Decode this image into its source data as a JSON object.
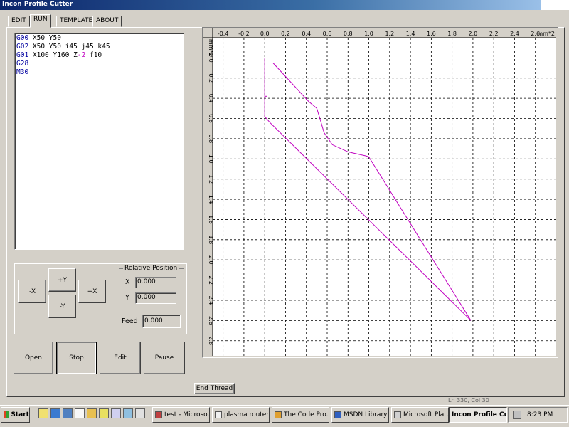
{
  "window": {
    "title": "Incon Profile Cutter"
  },
  "tabs": [
    {
      "label": "EDIT",
      "active": false
    },
    {
      "label": "RUN",
      "active": true
    },
    {
      "label": "TEMPLATE",
      "active": false
    },
    {
      "label": "ABOUT",
      "active": false
    }
  ],
  "editor": {
    "lines": [
      {
        "cmd": "G00",
        "rest": " X50 Y50",
        "neg": "",
        "tail": ""
      },
      {
        "cmd": "G02",
        "rest": " X50 Y50 i45 j45 k45",
        "neg": "",
        "tail": ""
      },
      {
        "cmd": "G01",
        "rest": " X100 Y160 Z",
        "neg": "-2",
        "tail": " f10"
      },
      {
        "cmd": "G28",
        "rest": "",
        "neg": "",
        "tail": ""
      },
      {
        "cmd": "M30",
        "rest": "",
        "neg": "",
        "tail": ""
      }
    ]
  },
  "jog": {
    "minus_x": "-X",
    "plus_y": "+Y",
    "plus_x": "+X",
    "minus_y": "-Y"
  },
  "relative_position": {
    "title": "Relative Position",
    "x_label": "X",
    "x_value": "0.000",
    "y_label": "Y",
    "y_value": "0.000"
  },
  "feed": {
    "label": "Feed",
    "value": "0.000"
  },
  "controls": {
    "open": "Open",
    "stop": "Stop",
    "edit": "Edit",
    "pause": "Pause"
  },
  "end_thread": "End Thread",
  "status_line": "Ln 330, Col 30",
  "plot": {
    "x_unit": "mm*2",
    "y_unit": "mm*2",
    "x_ticks": [
      "-0.4",
      "-0.2",
      "0.0",
      "0.2",
      "0.4",
      "0.6",
      "0.8",
      "1.0",
      "1.2",
      "1.4",
      "1.6",
      "1.8",
      "2.0",
      "2.2",
      "2.4",
      "2.6"
    ],
    "y_ticks": [
      "0.0",
      "0.2",
      "0.4",
      "0.6",
      "0.8",
      "1.0",
      "1.2",
      "1.4",
      "1.6",
      "1.8",
      "2.0",
      "2.2",
      "2.4",
      "2.6",
      "2.8"
    ],
    "path_color": "#c000c0"
  },
  "chart_data": {
    "type": "line",
    "xlim": [
      -0.5,
      2.8
    ],
    "ylim": [
      -0.2,
      2.95
    ],
    "y_inverted": true,
    "grid": true,
    "series": [
      {
        "values": [
          [
            0.0,
            0.0
          ],
          [
            0.0,
            0.58
          ],
          [
            0.05,
            0.64
          ],
          [
            1.98,
            2.6
          ],
          [
            1.0,
            0.98
          ],
          [
            0.97,
            0.97
          ],
          [
            0.8,
            0.93
          ],
          [
            0.65,
            0.86
          ],
          [
            0.57,
            0.74
          ],
          [
            0.53,
            0.6
          ],
          [
            0.5,
            0.5
          ],
          [
            0.42,
            0.43
          ],
          [
            0.08,
            0.05
          ]
        ]
      },
      {
        "values": [
          [
            0.0,
            0.38
          ],
          [
            0.02,
            0.38
          ]
        ]
      }
    ]
  },
  "taskbar": {
    "start": "Start",
    "items": [
      {
        "label": "test - Microso...",
        "active": false
      },
      {
        "label": "plasma router",
        "active": false
      },
      {
        "label": "The Code Pro...",
        "active": false
      },
      {
        "label": "MSDN Library ...",
        "active": false
      },
      {
        "label": "Microsoft Plat...",
        "active": false
      },
      {
        "label": "Incon Profile Cu...",
        "active": true
      }
    ],
    "clock": "8:23 PM"
  }
}
